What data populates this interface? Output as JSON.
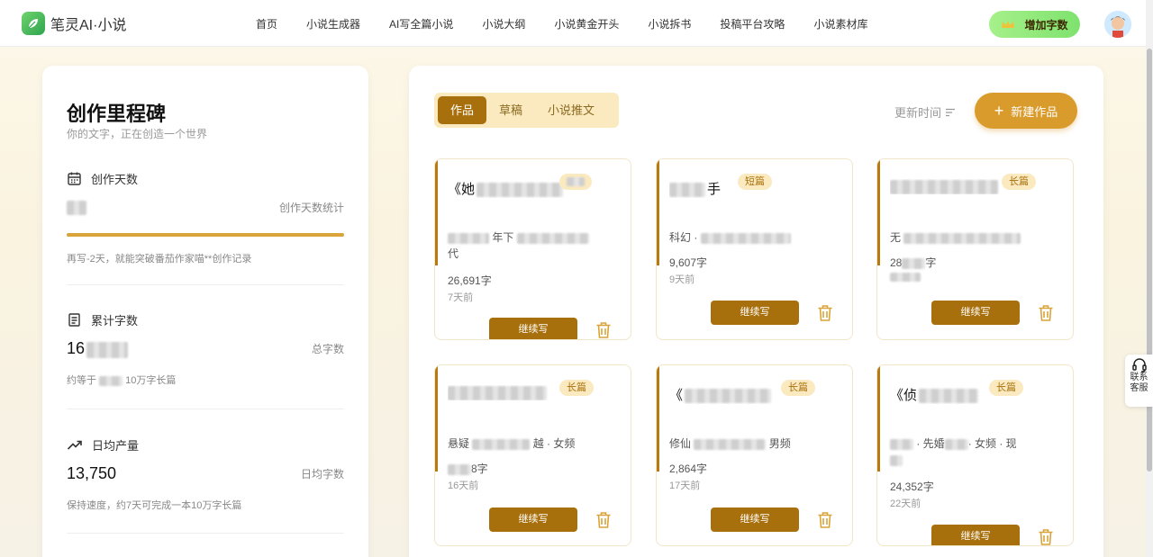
{
  "header": {
    "logo_text": "笔灵AI·小说",
    "nav": [
      "首页",
      "小说生成器",
      "AI写全篇小说",
      "小说大纲",
      "小说黄金开头",
      "小说拆书",
      "投稿平台攻略",
      "小说素材库"
    ],
    "add_words_label": "增加字数"
  },
  "milestone": {
    "title": "创作里程碑",
    "subtitle": "你的文字，正在创造一个世界",
    "days": {
      "heading": "创作天数",
      "label": "创作天数统计",
      "progress": 1.0,
      "note": "再写-2天，就能突破番茄作家喵**创作记录"
    },
    "total": {
      "heading": "累计字数",
      "value_visible": "16",
      "label": "总字数",
      "note_prefix": "约等于",
      "note_suffix": "10万字长篇"
    },
    "daily": {
      "heading": "日均产量",
      "value": "13,750",
      "label": "日均字数",
      "note": "保持速度，约7天可完成一本10万字长篇"
    }
  },
  "works": {
    "tabs": [
      "作品",
      "草稿",
      "小说推文"
    ],
    "active_tab": 0,
    "sort_label": "更新时间",
    "new_button": "新建作品",
    "continue_label": "继续写",
    "cards": [
      {
        "title": "《她",
        "badge": "",
        "meta": "年下",
        "meta2": "代",
        "words": "26,691字",
        "time": "7天前"
      },
      {
        "title": "手",
        "badge": "短篇",
        "meta": "科幻 ·",
        "meta2": "",
        "words": "9,607字",
        "time": "9天前"
      },
      {
        "title": "",
        "badge": "长篇",
        "meta": "无",
        "meta2": "",
        "words": "28",
        "time": ""
      },
      {
        "title": "",
        "badge": "长篇",
        "meta": "悬疑",
        "meta2": "越 · 女频",
        "words": "8字",
        "time": "16天前"
      },
      {
        "title": "《",
        "badge": "长篇",
        "meta": "修仙",
        "meta2": "男频",
        "words": "2,864字",
        "time": "17天前"
      },
      {
        "title": "《侦",
        "badge": "长篇",
        "meta": "· 先婚",
        "meta2": "· 女频 · 现",
        "words": "24,352字",
        "time": "22天前"
      }
    ]
  },
  "service": {
    "line1": "联系",
    "line2": "客服"
  }
}
